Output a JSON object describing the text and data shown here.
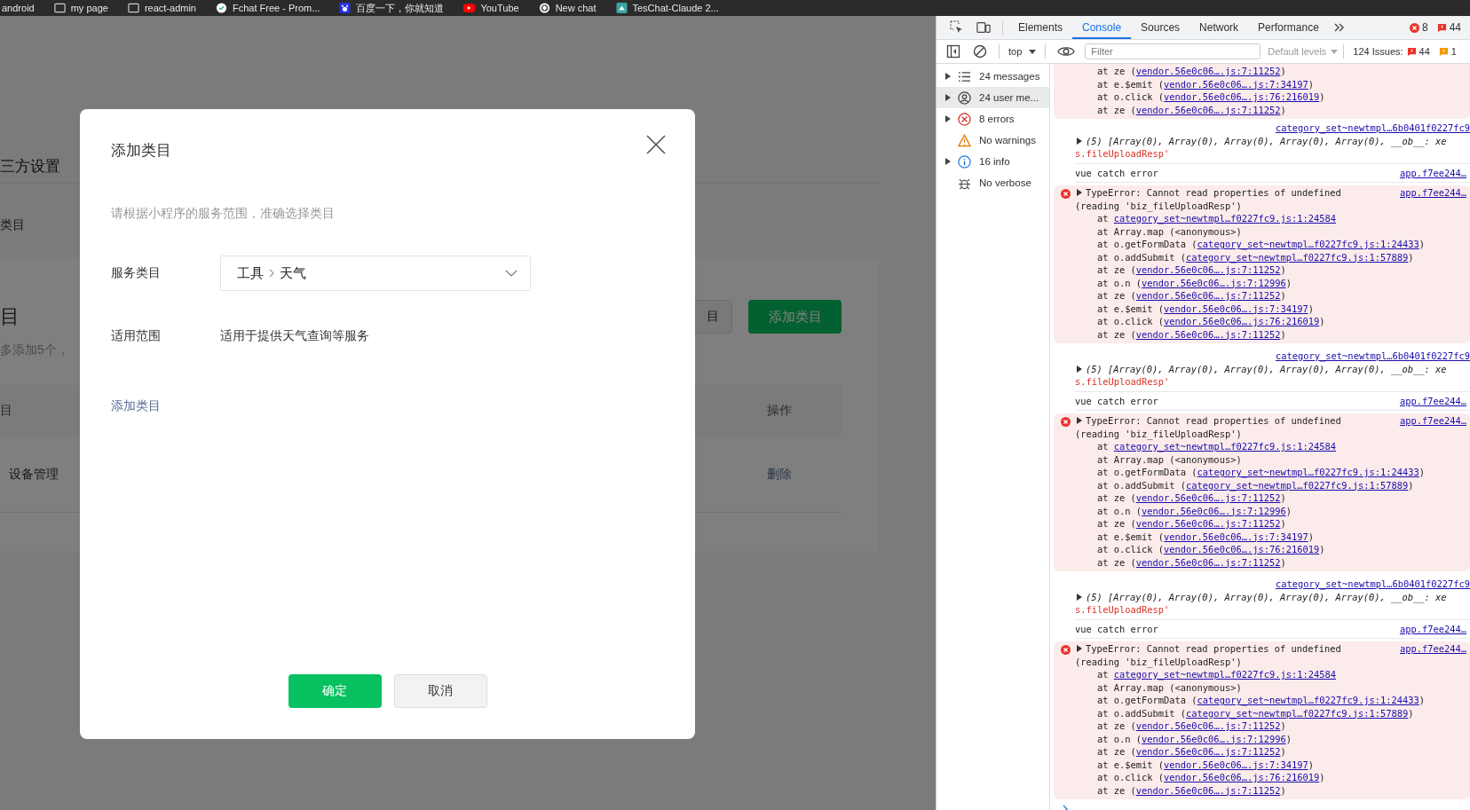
{
  "bookmarks": [
    {
      "label": "android",
      "kind": "none"
    },
    {
      "label": "my page",
      "kind": "page"
    },
    {
      "label": "react-admin",
      "kind": "page"
    },
    {
      "label": "Fchat Free - Prom...",
      "kind": "chat"
    },
    {
      "label": "百度一下，你就知道",
      "kind": "baidu"
    },
    {
      "label": "YouTube",
      "kind": "video"
    },
    {
      "label": "New chat",
      "kind": "spiral"
    },
    {
      "label": "TesChat-Claude 2...",
      "kind": "tes"
    }
  ],
  "page": {
    "nav_tab": "三方设置",
    "section_label": "类目",
    "heading": "目",
    "note": "多添加5个，",
    "outline_button": "目",
    "add_button": "添加类目",
    "table": {
      "columns": [
        "目",
        "操作"
      ],
      "rows": [
        [
          "设备管理",
          "删除"
        ]
      ]
    }
  },
  "modal": {
    "title": "添加类目",
    "hint": "请根据小程序的服务范围，准确选择类目",
    "fields": [
      {
        "kind": "select",
        "label": "服务类目",
        "path": [
          "工具",
          "天气"
        ]
      },
      {
        "kind": "text",
        "label": "适用范围",
        "value": "适用于提供天气查询等服务"
      }
    ],
    "link": "添加类目",
    "buttons": [
      {
        "label": "确定",
        "kind": "primary"
      },
      {
        "label": "取消",
        "kind": "secondary"
      }
    ]
  },
  "devtools": {
    "tabs": [
      {
        "label": "Elements",
        "selected": false
      },
      {
        "label": "Console",
        "selected": true
      },
      {
        "label": "Sources",
        "selected": false
      },
      {
        "label": "Network",
        "selected": false
      },
      {
        "label": "Performance",
        "selected": false
      }
    ],
    "error_count": "8",
    "issue_count": "44",
    "context": "top",
    "filter_placeholder": "Filter",
    "levels": "Default levels",
    "issues_label": "124 Issues:",
    "issues_errors": "44",
    "issues_warnings": "1",
    "sidebar": [
      {
        "label": "24 messages",
        "kind": "list",
        "expandable": true,
        "selected": false
      },
      {
        "label": "24 user me...",
        "kind": "user",
        "expandable": true,
        "selected": true
      },
      {
        "label": "8 errors",
        "kind": "error",
        "expandable": true,
        "selected": false
      },
      {
        "label": "No warnings",
        "kind": "warning",
        "expandable": false,
        "selected": false
      },
      {
        "label": "16 info",
        "kind": "info",
        "expandable": true,
        "selected": false
      },
      {
        "label": "No verbose",
        "kind": "verbose",
        "expandable": false,
        "selected": false
      }
    ],
    "messages": [
      {
        "kind": "stack",
        "frames": [
          {
            "text": "at ze (",
            "link": "vendor.56e0c06….js:7:11252",
            "end": ")"
          },
          {
            "text": "at e.$emit (",
            "link": "vendor.56e0c06….js:7:34197",
            "end": ")"
          },
          {
            "text": "at o.click (",
            "link": "vendor.56e0c06….js:76:216019",
            "end": ")"
          },
          {
            "text": "at ze (",
            "link": "vendor.56e0c06….js:7:11252",
            "end": ")"
          }
        ]
      },
      {
        "kind": "log",
        "source": "category_set~newtmpl…6b0401f0227fc9",
        "text": "(5) [Array(0), Array(0), Array(0), Array(0), Array(0), __ob__: xe",
        "tail": "s.fileUploadResp'"
      },
      {
        "kind": "plain",
        "text": "vue catch error",
        "source": "app.f7ee244…"
      },
      {
        "kind": "error",
        "text": "TypeError: Cannot read properties of undefined",
        "source": "app.f7ee244…",
        "detail": "(reading 'biz_fileUploadResp')",
        "frames": [
          {
            "text": "at ",
            "link": "category_set~newtmpl…f0227fc9.js:1:24584"
          },
          {
            "text": "at Array.map (<anonymous>)"
          },
          {
            "text": "at o.getFormData (",
            "link": "category_set~newtmpl…f0227fc9.js:1:24433",
            "end": ")"
          },
          {
            "text": "at o.addSubmit (",
            "link": "category_set~newtmpl…f0227fc9.js:1:57889",
            "end": ")"
          },
          {
            "text": "at ze (",
            "link": "vendor.56e0c06….js:7:11252",
            "end": ")"
          },
          {
            "text": "at o.n (",
            "link": "vendor.56e0c06….js:7:12996",
            "end": ")"
          },
          {
            "text": "at ze (",
            "link": "vendor.56e0c06….js:7:11252",
            "end": ")"
          },
          {
            "text": "at e.$emit (",
            "link": "vendor.56e0c06….js:7:34197",
            "end": ")"
          },
          {
            "text": "at o.click (",
            "link": "vendor.56e0c06….js:76:216019",
            "end": ")"
          },
          {
            "text": "at ze (",
            "link": "vendor.56e0c06….js:7:11252",
            "end": ")"
          }
        ]
      },
      {
        "kind": "log",
        "source": "category_set~newtmpl…6b0401f0227fc9",
        "text": "(5) [Array(0), Array(0), Array(0), Array(0), Array(0), __ob__: xe",
        "tail": "s.fileUploadResp'"
      },
      {
        "kind": "plain",
        "text": "vue catch error",
        "source": "app.f7ee244…"
      },
      {
        "kind": "error",
        "text": "TypeError: Cannot read properties of undefined",
        "source": "app.f7ee244…",
        "detail": "(reading 'biz_fileUploadResp')",
        "frames": [
          {
            "text": "at ",
            "link": "category_set~newtmpl…f0227fc9.js:1:24584"
          },
          {
            "text": "at Array.map (<anonymous>)"
          },
          {
            "text": "at o.getFormData (",
            "link": "category_set~newtmpl…f0227fc9.js:1:24433",
            "end": ")"
          },
          {
            "text": "at o.addSubmit (",
            "link": "category_set~newtmpl…f0227fc9.js:1:57889",
            "end": ")"
          },
          {
            "text": "at ze (",
            "link": "vendor.56e0c06….js:7:11252",
            "end": ")"
          },
          {
            "text": "at o.n (",
            "link": "vendor.56e0c06….js:7:12996",
            "end": ")"
          },
          {
            "text": "at ze (",
            "link": "vendor.56e0c06….js:7:11252",
            "end": ")"
          },
          {
            "text": "at e.$emit (",
            "link": "vendor.56e0c06….js:7:34197",
            "end": ")"
          },
          {
            "text": "at o.click (",
            "link": "vendor.56e0c06….js:76:216019",
            "end": ")"
          },
          {
            "text": "at ze (",
            "link": "vendor.56e0c06….js:7:11252",
            "end": ")"
          }
        ]
      },
      {
        "kind": "log",
        "source": "category_set~newtmpl…6b0401f0227fc9",
        "text": "(5) [Array(0), Array(0), Array(0), Array(0), Array(0), __ob__: xe",
        "tail": "s.fileUploadResp'"
      },
      {
        "kind": "plain",
        "text": "vue catch error",
        "source": "app.f7ee244…"
      },
      {
        "kind": "error",
        "text": "TypeError: Cannot read properties of undefined",
        "source": "app.f7ee244…",
        "detail": "(reading 'biz_fileUploadResp')",
        "frames": [
          {
            "text": "at ",
            "link": "category_set~newtmpl…f0227fc9.js:1:24584"
          },
          {
            "text": "at Array.map (<anonymous>)"
          },
          {
            "text": "at o.getFormData (",
            "link": "category_set~newtmpl…f0227fc9.js:1:24433",
            "end": ")"
          },
          {
            "text": "at o.addSubmit (",
            "link": "category_set~newtmpl…f0227fc9.js:1:57889",
            "end": ")"
          },
          {
            "text": "at ze (",
            "link": "vendor.56e0c06….js:7:11252",
            "end": ")"
          },
          {
            "text": "at o.n (",
            "link": "vendor.56e0c06….js:7:12996",
            "end": ")"
          },
          {
            "text": "at ze (",
            "link": "vendor.56e0c06….js:7:11252",
            "end": ")"
          },
          {
            "text": "at e.$emit (",
            "link": "vendor.56e0c06….js:7:34197",
            "end": ")"
          },
          {
            "text": "at o.click (",
            "link": "vendor.56e0c06….js:76:216019",
            "end": ")"
          },
          {
            "text": "at ze (",
            "link": "vendor.56e0c06….js:7:11252",
            "end": ")"
          }
        ]
      }
    ]
  }
}
